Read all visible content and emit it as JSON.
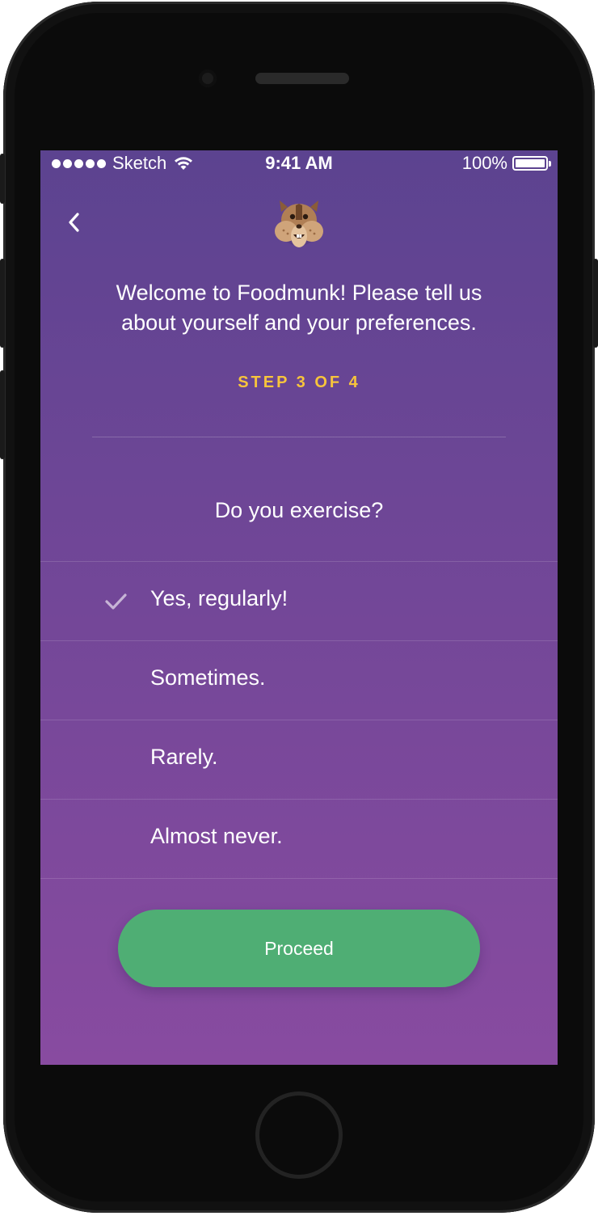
{
  "status_bar": {
    "carrier": "Sketch",
    "time": "9:41 AM",
    "battery": "100%",
    "battery_level": 1.0
  },
  "header": {
    "back_icon": "chevron-left-icon",
    "mascot_icon": "chipmunk-mascot-icon"
  },
  "intro": {
    "headline_line1": "Welcome to Foodmunk! Please tell us",
    "headline_line2": "about yourself and your preferences.",
    "step": "STEP 3 OF 4"
  },
  "question": {
    "text": "Do you exercise?",
    "options": [
      {
        "label": "Yes, regularly!",
        "selected": true
      },
      {
        "label": "Sometimes.",
        "selected": false
      },
      {
        "label": "Rarely.",
        "selected": false
      },
      {
        "label": "Almost never.",
        "selected": false
      }
    ]
  },
  "actions": {
    "proceed_label": "Proceed"
  },
  "colors": {
    "background_top": "#5c4390",
    "background_bottom": "#884ba0",
    "step_accent": "#f7c43c",
    "button": "#4fae74"
  }
}
